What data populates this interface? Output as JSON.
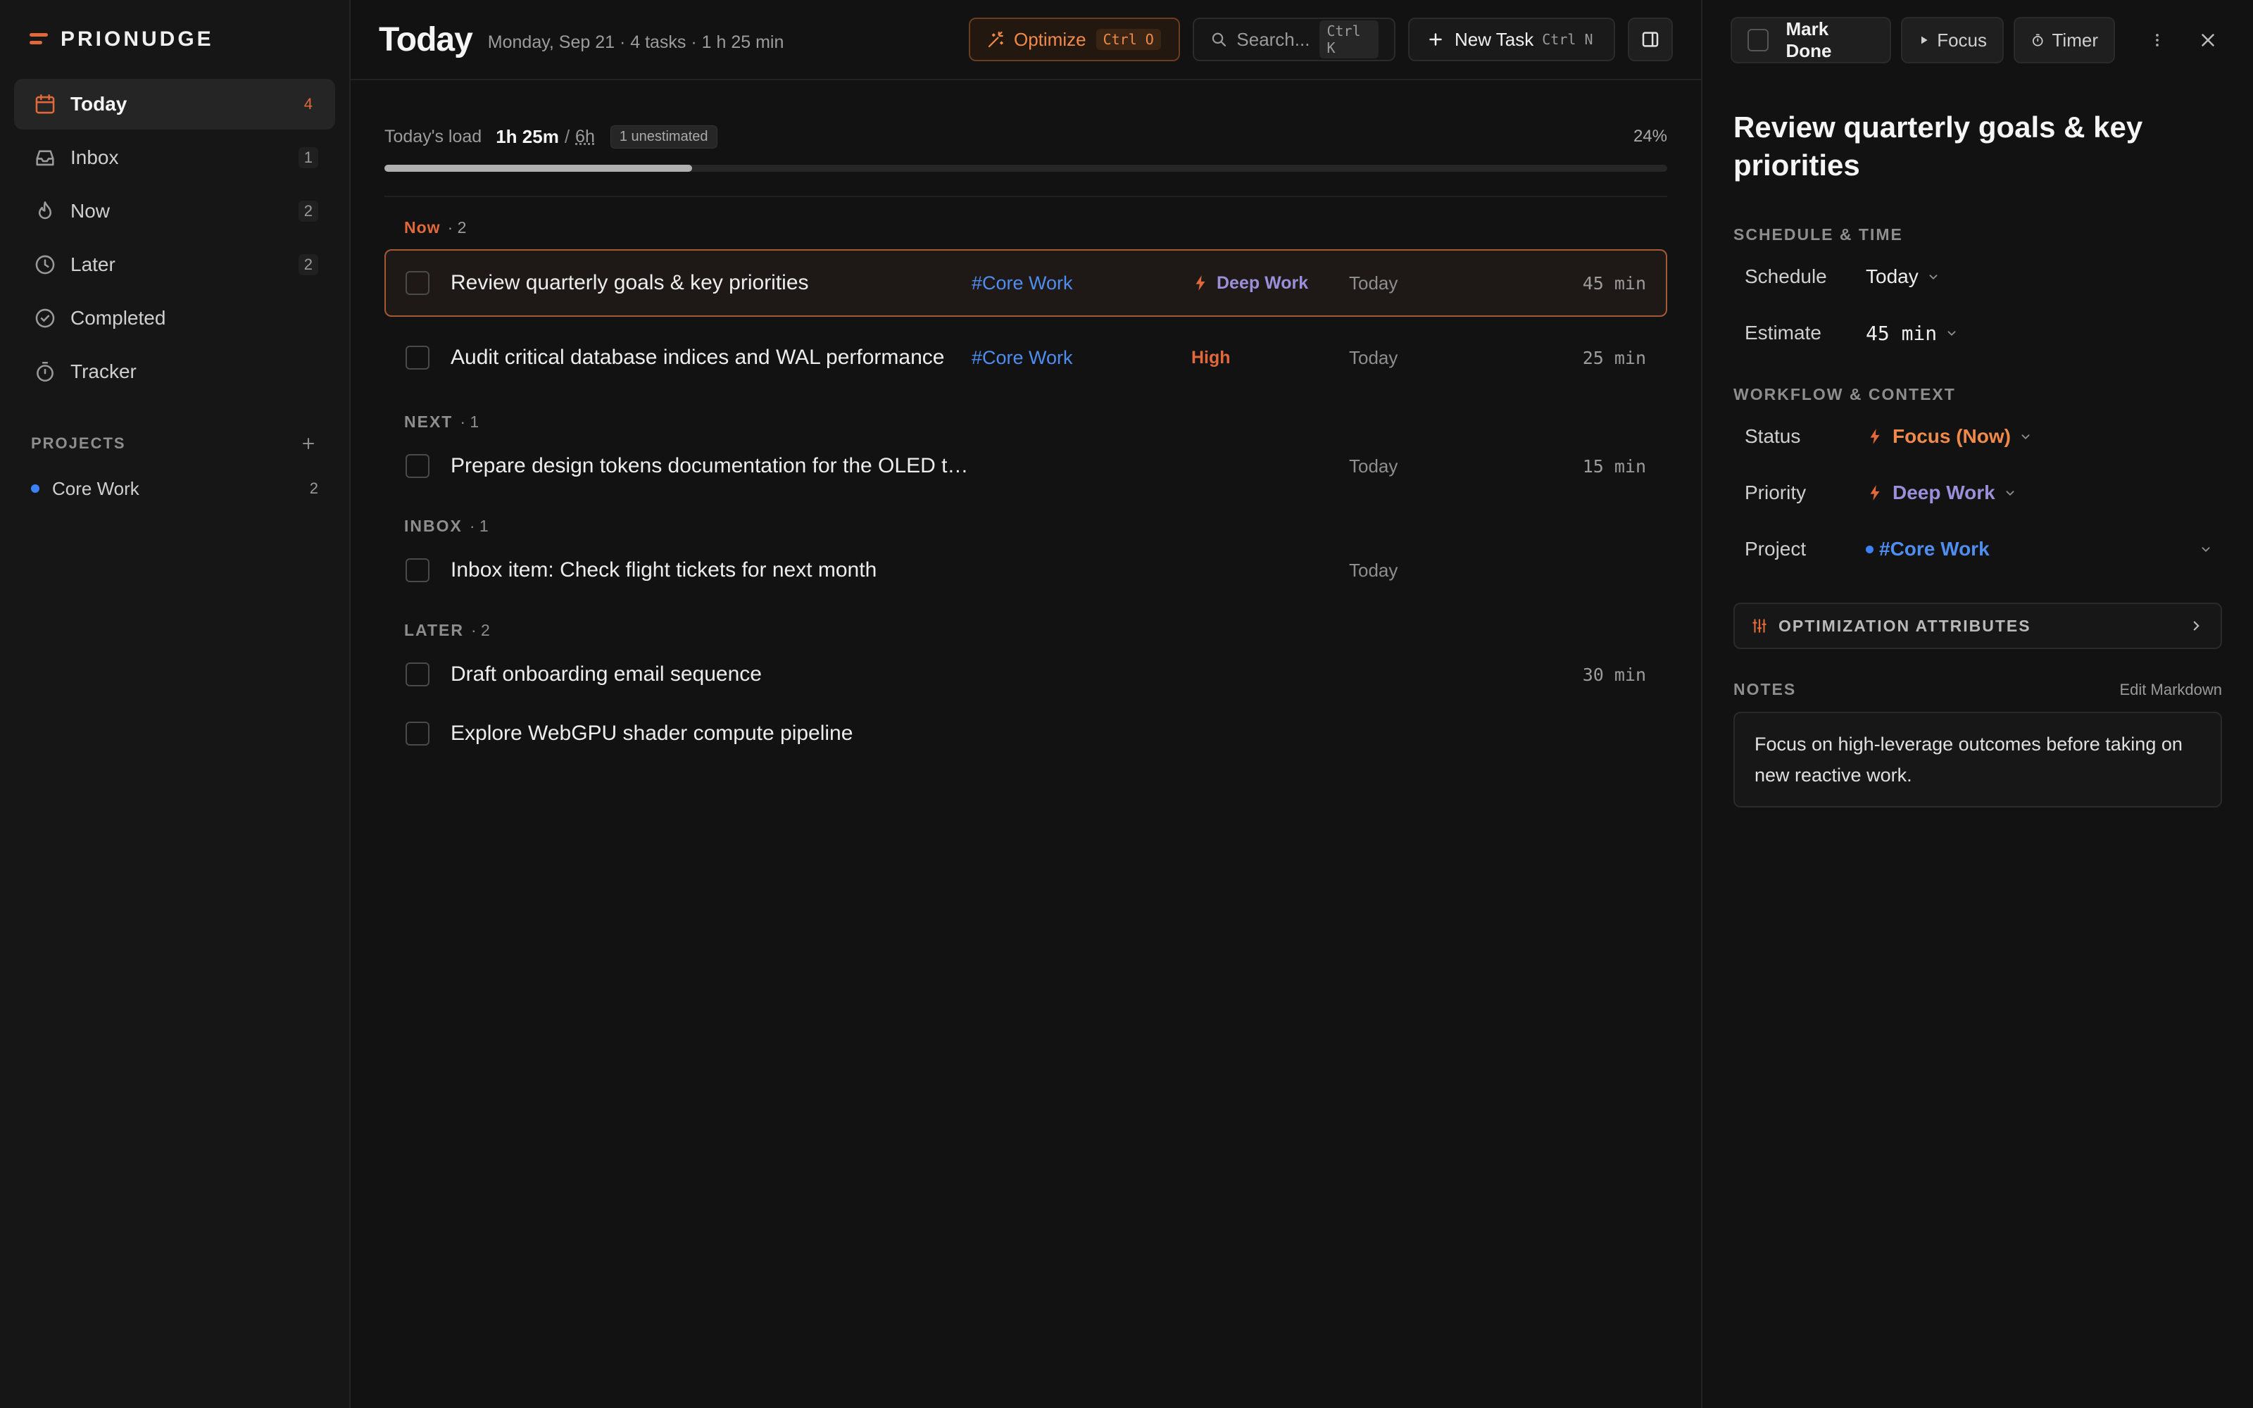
{
  "app": {
    "name": "PRIONUDGE"
  },
  "colors": {
    "accent": "#e0683a",
    "project_blue": "#4f8ef0",
    "deep_work_purple": "#9b8fd9"
  },
  "sidebar": {
    "items": [
      {
        "label": "Today",
        "count": "4",
        "icon": "calendar-icon"
      },
      {
        "label": "Inbox",
        "count": "1",
        "icon": "inbox-icon"
      },
      {
        "label": "Now",
        "count": "2",
        "icon": "flame-icon"
      },
      {
        "label": "Later",
        "count": "2",
        "icon": "clock-icon"
      },
      {
        "label": "Completed",
        "count": "",
        "icon": "check-circle-icon"
      },
      {
        "label": "Tracker",
        "count": "",
        "icon": "stopwatch-icon"
      }
    ],
    "projects_title": "PROJECTS",
    "projects": [
      {
        "label": "Core Work",
        "count": "2",
        "color": "#3b82f6"
      }
    ]
  },
  "header": {
    "title": "Today",
    "subtitle": "Monday, Sep 21 · 4 tasks · 1 h 25 min",
    "optimize_label": "Optimize",
    "optimize_shortcut": "Ctrl O",
    "search_placeholder": "Search...",
    "search_shortcut": "Ctrl K",
    "new_task_label": "New Task",
    "new_task_shortcut": "Ctrl N"
  },
  "load": {
    "label": "Today's load",
    "used": "1h 25m",
    "separator": "/",
    "capacity": "6h",
    "badge": "1 unestimated",
    "percent_text": "24%",
    "percent": 24
  },
  "sections": {
    "now": {
      "label": "Now",
      "count": "2"
    },
    "next": {
      "label": "NEXT",
      "count": "1"
    },
    "inbox": {
      "label": "INBOX",
      "count": "1"
    },
    "later": {
      "label": "LATER",
      "count": "2"
    }
  },
  "tasks": [
    {
      "title": "Review quarterly goals & key priorities",
      "project": "#Core Work",
      "priority": "Deep Work",
      "when": "Today",
      "estimate": "45 min"
    },
    {
      "title": "Audit critical database indices and WAL performance",
      "project": "#Core Work",
      "priority": "High",
      "when": "Today",
      "estimate": "25 min"
    },
    {
      "title": "Prepare design tokens documentation for the OLED theme",
      "project": "",
      "priority": "",
      "when": "Today",
      "estimate": "15 min"
    },
    {
      "title": "Inbox item: Check flight tickets for next month",
      "project": "",
      "priority": "",
      "when": "Today",
      "estimate": ""
    },
    {
      "title": "Draft onboarding email sequence",
      "project": "",
      "priority": "",
      "when": "",
      "estimate": "30 min"
    },
    {
      "title": "Explore WebGPU shader compute pipeline",
      "project": "",
      "priority": "",
      "when": "",
      "estimate": ""
    }
  ],
  "detail": {
    "toolbar": {
      "mark_done": "Mark Done",
      "focus": "Focus",
      "timer": "Timer"
    },
    "title": "Review quarterly goals & key priorities",
    "schedule_section": "SCHEDULE & TIME",
    "schedule_label": "Schedule",
    "schedule_value": "Today",
    "estimate_label": "Estimate",
    "estimate_value": "45 min",
    "workflow_section": "WORKFLOW & CONTEXT",
    "status_label": "Status",
    "status_value": "Focus (Now)",
    "priority_label": "Priority",
    "priority_value": "Deep Work",
    "project_label": "Project",
    "project_value": "#Core Work",
    "optimization_label": "OPTIMIZATION ATTRIBUTES",
    "notes_title": "NOTES",
    "notes_edit": "Edit Markdown",
    "notes_text": "Focus on high-leverage outcomes before taking on new reactive work."
  }
}
